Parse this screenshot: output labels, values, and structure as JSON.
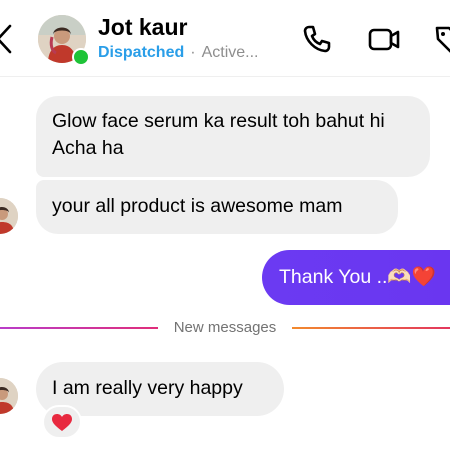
{
  "header": {
    "contact_name": "Jot kaur",
    "status": "Dispatched",
    "separator": "·",
    "activity": "Active...",
    "icons": [
      "back-chevron-icon",
      "phone-icon",
      "video-camera-icon",
      "tag-icon"
    ]
  },
  "messages": [
    {
      "direction": "incoming",
      "text": "Glow face serum ka result toh bahut hi Acha ha"
    },
    {
      "direction": "incoming",
      "text": "your all product is awesome mam"
    },
    {
      "direction": "outgoing",
      "text": "Thank You ..🫶🏻❤️"
    },
    {
      "direction": "incoming",
      "text": "I am really very happy",
      "reaction": "❤️"
    }
  ],
  "divider": {
    "label": "New messages"
  },
  "colors": {
    "status_blue": "#2a9ee8",
    "online_green": "#1ec337",
    "outgoing_bubble": "#6b3af2",
    "incoming_bubble": "#efefef",
    "reaction_red": "#e8293f"
  }
}
